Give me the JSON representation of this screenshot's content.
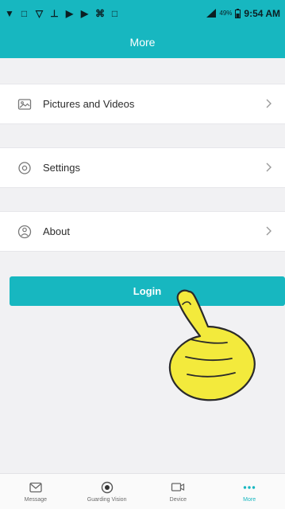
{
  "status_bar": {
    "time": "9:54 AM",
    "battery": "49%",
    "left_icons": [
      "▼",
      "□",
      "▽",
      "⊥",
      "▶",
      "▶",
      "⌘",
      "□"
    ]
  },
  "header": {
    "title": "More"
  },
  "menu": {
    "items": [
      {
        "label": "Pictures and Videos",
        "icon": "image-icon"
      },
      {
        "label": "Settings",
        "icon": "settings-icon"
      },
      {
        "label": "About",
        "icon": "about-icon"
      }
    ]
  },
  "login": {
    "label": "Login"
  },
  "bottom_nav": {
    "items": [
      {
        "label": "Message",
        "icon": "message-icon"
      },
      {
        "label": "Guarding Vision",
        "icon": "guarding-vision-icon"
      },
      {
        "label": "Device",
        "icon": "device-icon"
      },
      {
        "label": "More",
        "icon": "more-icon"
      }
    ],
    "active": "More"
  },
  "colors": {
    "accent": "#17b7c0",
    "background": "#f1f1f3"
  }
}
